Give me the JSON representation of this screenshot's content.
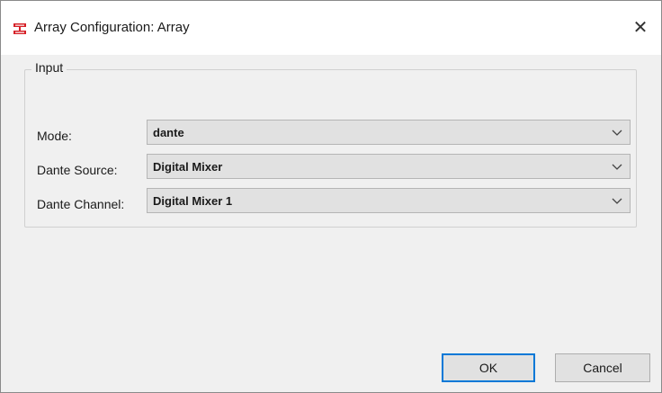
{
  "window": {
    "title": "Array Configuration: Array",
    "icon": "app-logo-icon",
    "close_glyph": "✕",
    "accent": "#d62027"
  },
  "input_group": {
    "label": "Input",
    "fields": [
      {
        "label": "Mode:",
        "value": "dante"
      },
      {
        "label": "Dante Source:",
        "value": "Digital Mixer"
      },
      {
        "label": "Dante Channel:",
        "value": "Digital Mixer 1"
      }
    ]
  },
  "buttons": {
    "ok": "OK",
    "cancel": "Cancel",
    "default_border": "#0078d7"
  }
}
